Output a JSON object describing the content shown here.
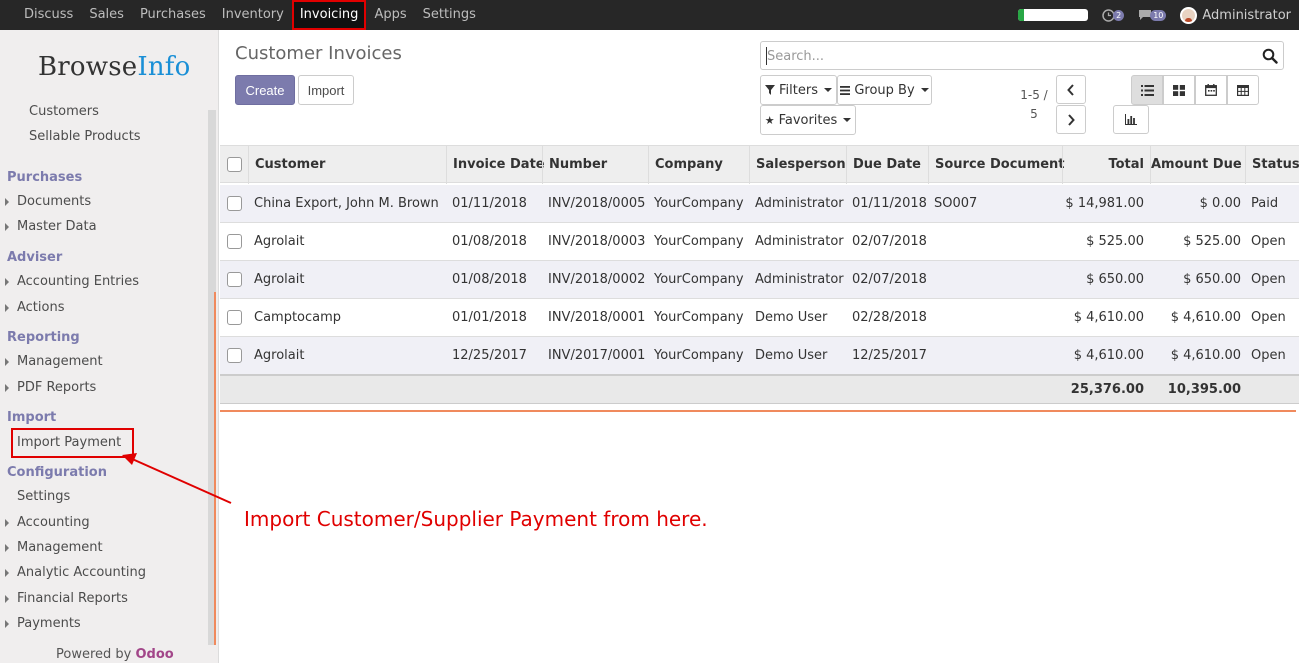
{
  "topbar": {
    "menu": [
      "Discuss",
      "Sales",
      "Purchases",
      "Inventory",
      "Invoicing",
      "Apps",
      "Settings"
    ],
    "active_menu": "Invoicing",
    "progress_fraction": 0.08,
    "activity_count": "2",
    "message_count": "10",
    "user_name": "Administrator"
  },
  "sidebar": {
    "logo_browse": "Browse",
    "logo_info": "Info",
    "items_top": [
      "Customers",
      "Sellable Products"
    ],
    "purchases_head": "Purchases",
    "purchases_items": [
      "Documents",
      "Master Data"
    ],
    "adviser_head": "Adviser",
    "adviser_items": [
      "Accounting Entries",
      "Actions"
    ],
    "reporting_head": "Reporting",
    "reporting_items": [
      "Management",
      "PDF Reports"
    ],
    "import_head": "Import",
    "import_payment": "Import Payment",
    "configuration_head": "Configuration",
    "configuration_items": [
      "Settings",
      "Accounting",
      "Management",
      "Analytic Accounting",
      "Financial Reports",
      "Payments"
    ],
    "powered_by": "Powered by",
    "powered_brand": "Odoo"
  },
  "control_panel": {
    "title": "Customer Invoices",
    "create_label": "Create",
    "import_label": "Import",
    "search_placeholder": "Search...",
    "filters_label": "Filters",
    "group_by_label": "Group By",
    "favorites_label": "Favorites",
    "pager_range": "1-5 /",
    "pager_total": "5"
  },
  "table": {
    "columns": [
      "Customer",
      "Invoice Date",
      "Number",
      "Company",
      "Salesperson",
      "Due Date",
      "Source Document",
      "Total",
      "Amount Due",
      "Status"
    ],
    "rows": [
      [
        "China Export, John M. Brown",
        "01/11/2018",
        "INV/2018/0005",
        "YourCompany",
        "Administrator",
        "01/11/2018",
        "SO007",
        "$ 14,981.00",
        "$ 0.00",
        "Paid"
      ],
      [
        "Agrolait",
        "01/08/2018",
        "INV/2018/0003",
        "YourCompany",
        "Administrator",
        "02/07/2018",
        "",
        "$ 525.00",
        "$ 525.00",
        "Open"
      ],
      [
        "Agrolait",
        "01/08/2018",
        "INV/2018/0002",
        "YourCompany",
        "Administrator",
        "02/07/2018",
        "",
        "$ 650.00",
        "$ 650.00",
        "Open"
      ],
      [
        "Camptocamp",
        "01/01/2018",
        "INV/2018/0001",
        "YourCompany",
        "Demo User",
        "02/28/2018",
        "",
        "$ 4,610.00",
        "$ 4,610.00",
        "Open"
      ],
      [
        "Agrolait",
        "12/25/2017",
        "INV/2017/0001",
        "YourCompany",
        "Demo User",
        "12/25/2017",
        "",
        "$ 4,610.00",
        "$ 4,610.00",
        "Open"
      ]
    ],
    "footer_total": "25,376.00",
    "footer_amount_due": "10,395.00"
  },
  "annotation": {
    "text": "Import Customer/Supplier Payment from here."
  }
}
